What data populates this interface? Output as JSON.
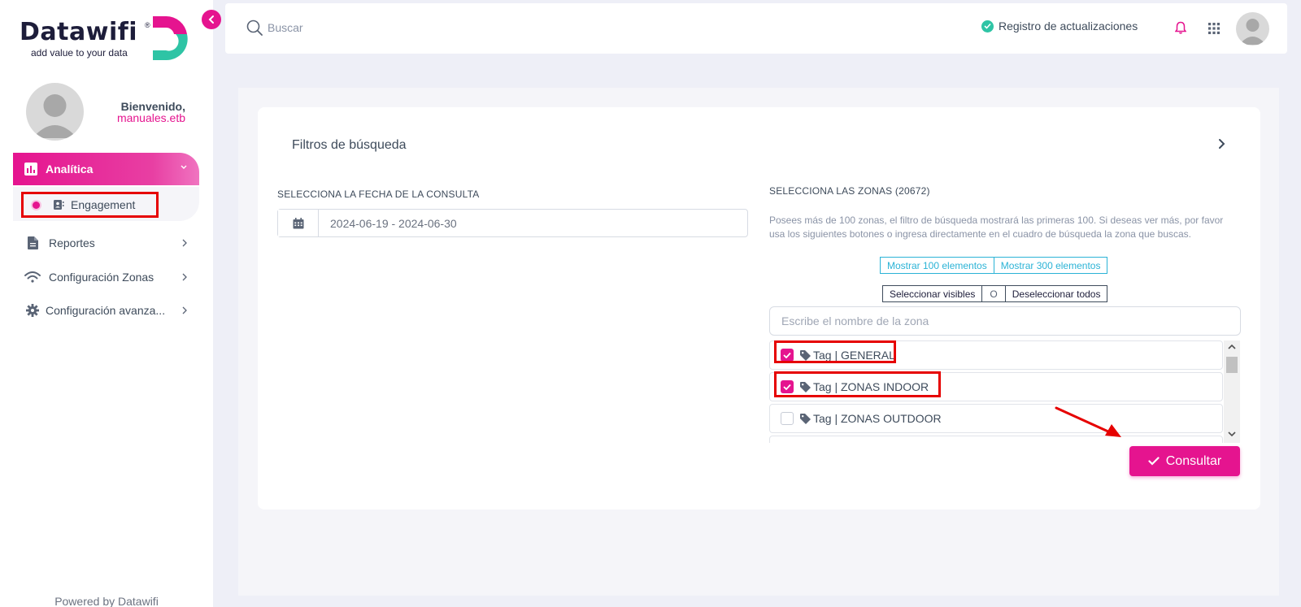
{
  "brand": {
    "name": "Datawifi",
    "registered": "®",
    "tagline": "add value to your data",
    "accent": "#e5148f",
    "secondary": "#2ec4a5"
  },
  "sidebar": {
    "welcome": "Bienvenido,",
    "username": "manuales.etb",
    "items": [
      {
        "label": "Analítica",
        "icon": "chart-icon",
        "active": true
      },
      {
        "label": "Engagement",
        "icon": "contact-card-icon",
        "active": true
      },
      {
        "label": "Reportes",
        "icon": "document-icon"
      },
      {
        "label": "Configuración Zonas",
        "icon": "wifi-icon"
      },
      {
        "label": "Configuración avanza...",
        "icon": "gear-icon"
      }
    ],
    "footer": "Powered by Datawifi"
  },
  "topbar": {
    "search_placeholder": "Buscar",
    "registro": "Registro de actualizaciones"
  },
  "filters": {
    "title": "Filtros de búsqueda",
    "date_label": "SELECCIONA LA FECHA DE LA CONSULTA",
    "date_value": "2024-06-19 - 2024-06-30",
    "zones_label": "SELECCIONA LAS ZONAS (20672)",
    "zones_info": "Posees más de 100 zonas, el filtro de búsqueda mostrará las primeras 100. Si deseas ver más, por favor usa los siguientes botones o ingresa directamente en el cuadro de búsqueda la zona que buscas.",
    "show_100": "Mostrar 100 elementos",
    "show_300": "Mostrar 300 elementos",
    "select_visible": "Seleccionar visibles",
    "or": "O",
    "deselect_all": "Deseleccionar todos",
    "zone_search_placeholder": "Escribe el nombre de la zona",
    "zones": [
      {
        "label": "Tag | GENERAL",
        "checked": true
      },
      {
        "label": "Tag | ZONAS INDOOR",
        "checked": true
      },
      {
        "label": "Tag | ZONAS OUTDOOR",
        "checked": false
      }
    ],
    "submit": "Consultar"
  }
}
